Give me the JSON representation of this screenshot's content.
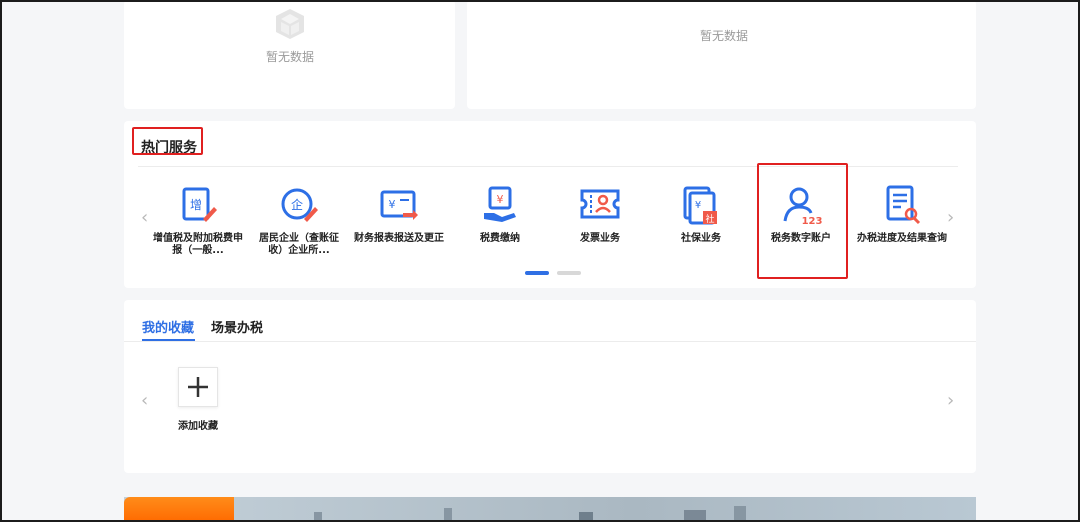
{
  "empty_state": {
    "left_text": "暂无数据",
    "right_text": "暂无数据"
  },
  "hot_services": {
    "title": "热门服务",
    "items": [
      {
        "label": "增值税及附加税费申报（一般...",
        "icon": "vat-declare-icon"
      },
      {
        "label": "居民企业（查账征收）企业所...",
        "icon": "enterprise-tax-icon"
      },
      {
        "label": "财务报表报送及更正",
        "icon": "financial-report-icon"
      },
      {
        "label": "税费缴纳",
        "icon": "tax-payment-icon"
      },
      {
        "label": "发票业务",
        "icon": "invoice-icon"
      },
      {
        "label": "社保业务",
        "icon": "social-security-icon"
      },
      {
        "label": "税务数字账户",
        "icon": "digital-account-icon"
      },
      {
        "label": "办税进度及结果查询",
        "icon": "progress-query-icon"
      }
    ],
    "carousel_pages": 2,
    "active_page": 1
  },
  "favorites": {
    "tabs": [
      "我的收藏",
      "场景办税"
    ],
    "active_tab": 0,
    "add_label": "添加收藏"
  },
  "colors": {
    "accent": "#2f6fe4",
    "highlight": "#e02020",
    "icon_blue": "#2d6fe6",
    "icon_red": "#f05a4a"
  }
}
